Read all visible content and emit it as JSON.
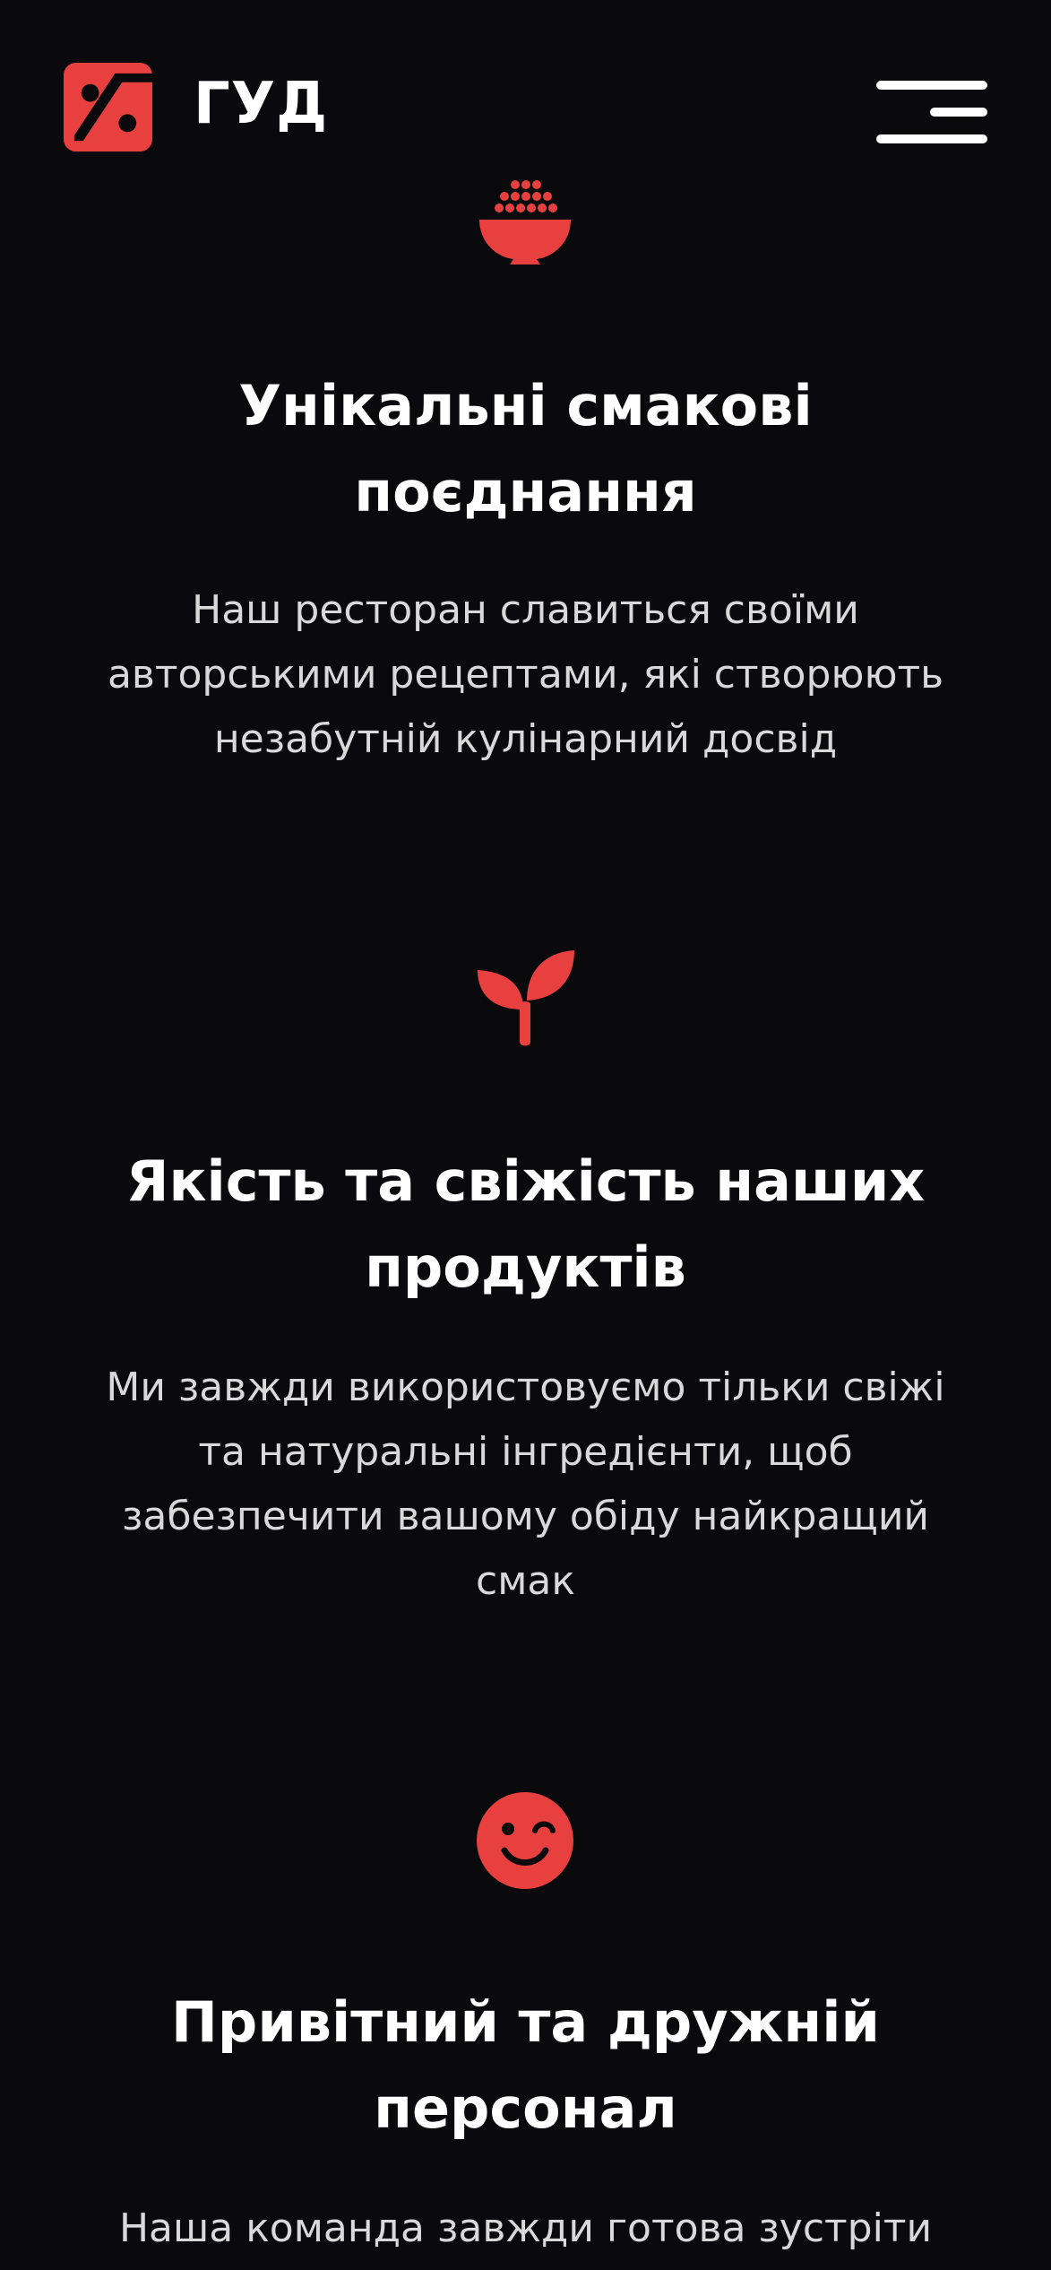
{
  "header": {
    "brand": "ГУД",
    "logo_icon": "percent-logo-icon",
    "menu_icon": "hamburger-menu-icon"
  },
  "colors": {
    "background": "#0a0a0c",
    "accent": "#e8403f",
    "text": "#ffffff",
    "muted_text": "#d9d9d9"
  },
  "features": [
    {
      "icon": "rice-bowl-icon",
      "title_line1": "Унікальні смакові",
      "title_line2": "поєднання",
      "desc_line1": "Наш ресторан славиться своїми",
      "desc_line2": "авторськими рецептами, які створюють",
      "desc_line3": "незабутній кулінарний досвід"
    },
    {
      "icon": "sprout-icon",
      "title_line1": "Якість та свіжість наших",
      "title_line2": "продуктів",
      "desc_line1": "Ми завжди використовуємо тільки свіжі",
      "desc_line2": "та натуральні інгредієнти, щоб",
      "desc_line3": "забезпечити вашому обіду найкращий",
      "desc_line4": "смак"
    },
    {
      "icon": "wink-face-icon",
      "title_line1": "Привітний та дружній",
      "title_line2": "персонал",
      "desc_line1": "Наша команда завжди готова зустріти"
    }
  ]
}
